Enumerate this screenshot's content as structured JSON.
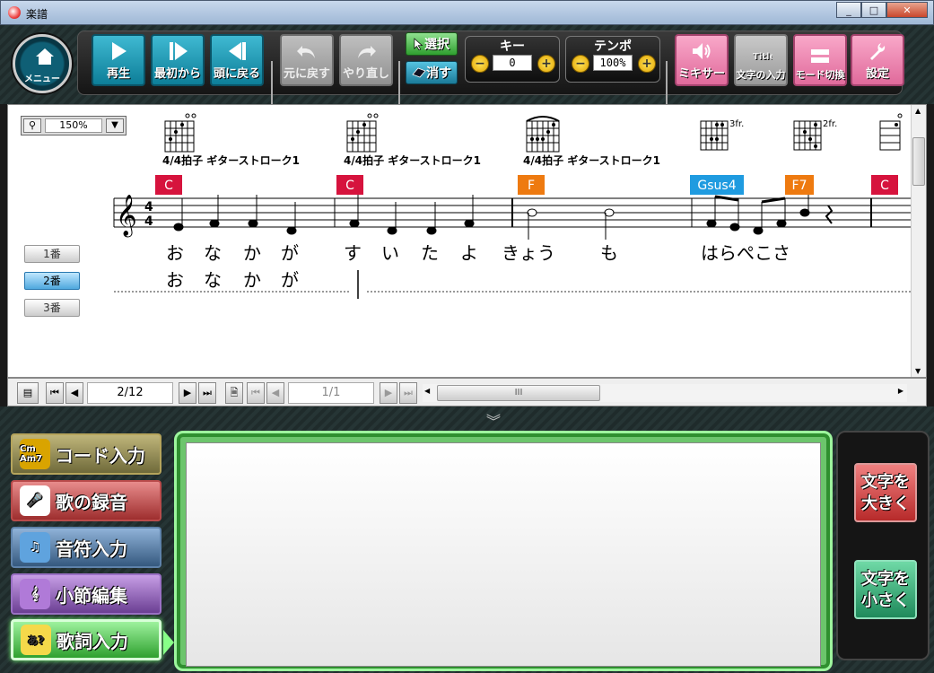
{
  "window": {
    "title": "楽譜",
    "min": "_",
    "max": "□",
    "close": "✕"
  },
  "toolbar": {
    "menu_label": "メニュー",
    "play": "再生",
    "from_start": "最初から",
    "back_to_head": "頭に戻る",
    "undo": "元に戻す",
    "redo": "やり直し",
    "select": "選択",
    "erase": "消す",
    "key": {
      "label": "キー",
      "value": "0"
    },
    "tempo": {
      "label": "テンポ",
      "value": "100%"
    },
    "mixer": "ミキサー",
    "text_input": "文字の入力",
    "mode_switch": "モード切換",
    "settings": "設定"
  },
  "score": {
    "zoom": "150%",
    "verses": [
      "1番",
      "2番",
      "3番"
    ],
    "active_verse": 1,
    "strokes": [
      "4/4拍子 ギターストローク1",
      "4/4拍子 ギターストローク1",
      "4/4拍子 ギターストローク1"
    ],
    "fret_labels": [
      "3fr.",
      "2fr."
    ],
    "chords": [
      "C",
      "C",
      "F",
      "Gsus4",
      "F7",
      "C"
    ],
    "lyrics_row1": [
      "お",
      "な",
      "か",
      "が",
      "す",
      "い",
      "た",
      "よ",
      "きょう",
      "も",
      "はらぺこさ"
    ],
    "lyrics_row2": [
      "お",
      "な",
      "か",
      "が"
    ]
  },
  "nav": {
    "measure": "2/12",
    "page": "1/1",
    "scroll_grip": "III"
  },
  "modes": [
    "コード入力",
    "歌の録音",
    "音符入力",
    "小節編集",
    "歌詞入力"
  ],
  "mode_icons": [
    "Cm Am7",
    "mic",
    "note",
    "staff",
    "あ?"
  ],
  "right": {
    "bigger": "文字を大きく",
    "smaller": "文字を小さく"
  },
  "colors": {
    "chord_red": "#d6133d",
    "chord_orange": "#ee7a10",
    "chord_blue": "#1f9be0"
  }
}
